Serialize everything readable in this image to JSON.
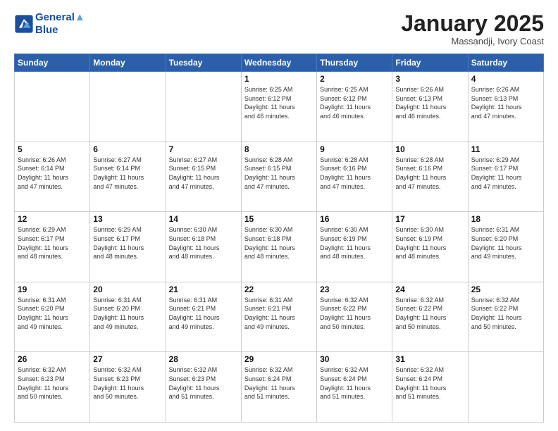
{
  "logo": {
    "line1": "General",
    "line2": "Blue"
  },
  "header": {
    "month": "January 2025",
    "location": "Massandji, Ivory Coast"
  },
  "weekdays": [
    "Sunday",
    "Monday",
    "Tuesday",
    "Wednesday",
    "Thursday",
    "Friday",
    "Saturday"
  ],
  "weeks": [
    [
      {
        "day": "",
        "info": ""
      },
      {
        "day": "",
        "info": ""
      },
      {
        "day": "",
        "info": ""
      },
      {
        "day": "1",
        "info": "Sunrise: 6:25 AM\nSunset: 6:12 PM\nDaylight: 11 hours\nand 46 minutes."
      },
      {
        "day": "2",
        "info": "Sunrise: 6:25 AM\nSunset: 6:12 PM\nDaylight: 11 hours\nand 46 minutes."
      },
      {
        "day": "3",
        "info": "Sunrise: 6:26 AM\nSunset: 6:13 PM\nDaylight: 11 hours\nand 46 minutes."
      },
      {
        "day": "4",
        "info": "Sunrise: 6:26 AM\nSunset: 6:13 PM\nDaylight: 11 hours\nand 47 minutes."
      }
    ],
    [
      {
        "day": "5",
        "info": "Sunrise: 6:26 AM\nSunset: 6:14 PM\nDaylight: 11 hours\nand 47 minutes."
      },
      {
        "day": "6",
        "info": "Sunrise: 6:27 AM\nSunset: 6:14 PM\nDaylight: 11 hours\nand 47 minutes."
      },
      {
        "day": "7",
        "info": "Sunrise: 6:27 AM\nSunset: 6:15 PM\nDaylight: 11 hours\nand 47 minutes."
      },
      {
        "day": "8",
        "info": "Sunrise: 6:28 AM\nSunset: 6:15 PM\nDaylight: 11 hours\nand 47 minutes."
      },
      {
        "day": "9",
        "info": "Sunrise: 6:28 AM\nSunset: 6:16 PM\nDaylight: 11 hours\nand 47 minutes."
      },
      {
        "day": "10",
        "info": "Sunrise: 6:28 AM\nSunset: 6:16 PM\nDaylight: 11 hours\nand 47 minutes."
      },
      {
        "day": "11",
        "info": "Sunrise: 6:29 AM\nSunset: 6:17 PM\nDaylight: 11 hours\nand 47 minutes."
      }
    ],
    [
      {
        "day": "12",
        "info": "Sunrise: 6:29 AM\nSunset: 6:17 PM\nDaylight: 11 hours\nand 48 minutes."
      },
      {
        "day": "13",
        "info": "Sunrise: 6:29 AM\nSunset: 6:17 PM\nDaylight: 11 hours\nand 48 minutes."
      },
      {
        "day": "14",
        "info": "Sunrise: 6:30 AM\nSunset: 6:18 PM\nDaylight: 11 hours\nand 48 minutes."
      },
      {
        "day": "15",
        "info": "Sunrise: 6:30 AM\nSunset: 6:18 PM\nDaylight: 11 hours\nand 48 minutes."
      },
      {
        "day": "16",
        "info": "Sunrise: 6:30 AM\nSunset: 6:19 PM\nDaylight: 11 hours\nand 48 minutes."
      },
      {
        "day": "17",
        "info": "Sunrise: 6:30 AM\nSunset: 6:19 PM\nDaylight: 11 hours\nand 48 minutes."
      },
      {
        "day": "18",
        "info": "Sunrise: 6:31 AM\nSunset: 6:20 PM\nDaylight: 11 hours\nand 49 minutes."
      }
    ],
    [
      {
        "day": "19",
        "info": "Sunrise: 6:31 AM\nSunset: 6:20 PM\nDaylight: 11 hours\nand 49 minutes."
      },
      {
        "day": "20",
        "info": "Sunrise: 6:31 AM\nSunset: 6:20 PM\nDaylight: 11 hours\nand 49 minutes."
      },
      {
        "day": "21",
        "info": "Sunrise: 6:31 AM\nSunset: 6:21 PM\nDaylight: 11 hours\nand 49 minutes."
      },
      {
        "day": "22",
        "info": "Sunrise: 6:31 AM\nSunset: 6:21 PM\nDaylight: 11 hours\nand 49 minutes."
      },
      {
        "day": "23",
        "info": "Sunrise: 6:32 AM\nSunset: 6:22 PM\nDaylight: 11 hours\nand 50 minutes."
      },
      {
        "day": "24",
        "info": "Sunrise: 6:32 AM\nSunset: 6:22 PM\nDaylight: 11 hours\nand 50 minutes."
      },
      {
        "day": "25",
        "info": "Sunrise: 6:32 AM\nSunset: 6:22 PM\nDaylight: 11 hours\nand 50 minutes."
      }
    ],
    [
      {
        "day": "26",
        "info": "Sunrise: 6:32 AM\nSunset: 6:23 PM\nDaylight: 11 hours\nand 50 minutes."
      },
      {
        "day": "27",
        "info": "Sunrise: 6:32 AM\nSunset: 6:23 PM\nDaylight: 11 hours\nand 50 minutes."
      },
      {
        "day": "28",
        "info": "Sunrise: 6:32 AM\nSunset: 6:23 PM\nDaylight: 11 hours\nand 51 minutes."
      },
      {
        "day": "29",
        "info": "Sunrise: 6:32 AM\nSunset: 6:24 PM\nDaylight: 11 hours\nand 51 minutes."
      },
      {
        "day": "30",
        "info": "Sunrise: 6:32 AM\nSunset: 6:24 PM\nDaylight: 11 hours\nand 51 minutes."
      },
      {
        "day": "31",
        "info": "Sunrise: 6:32 AM\nSunset: 6:24 PM\nDaylight: 11 hours\nand 51 minutes."
      },
      {
        "day": "",
        "info": ""
      }
    ]
  ]
}
